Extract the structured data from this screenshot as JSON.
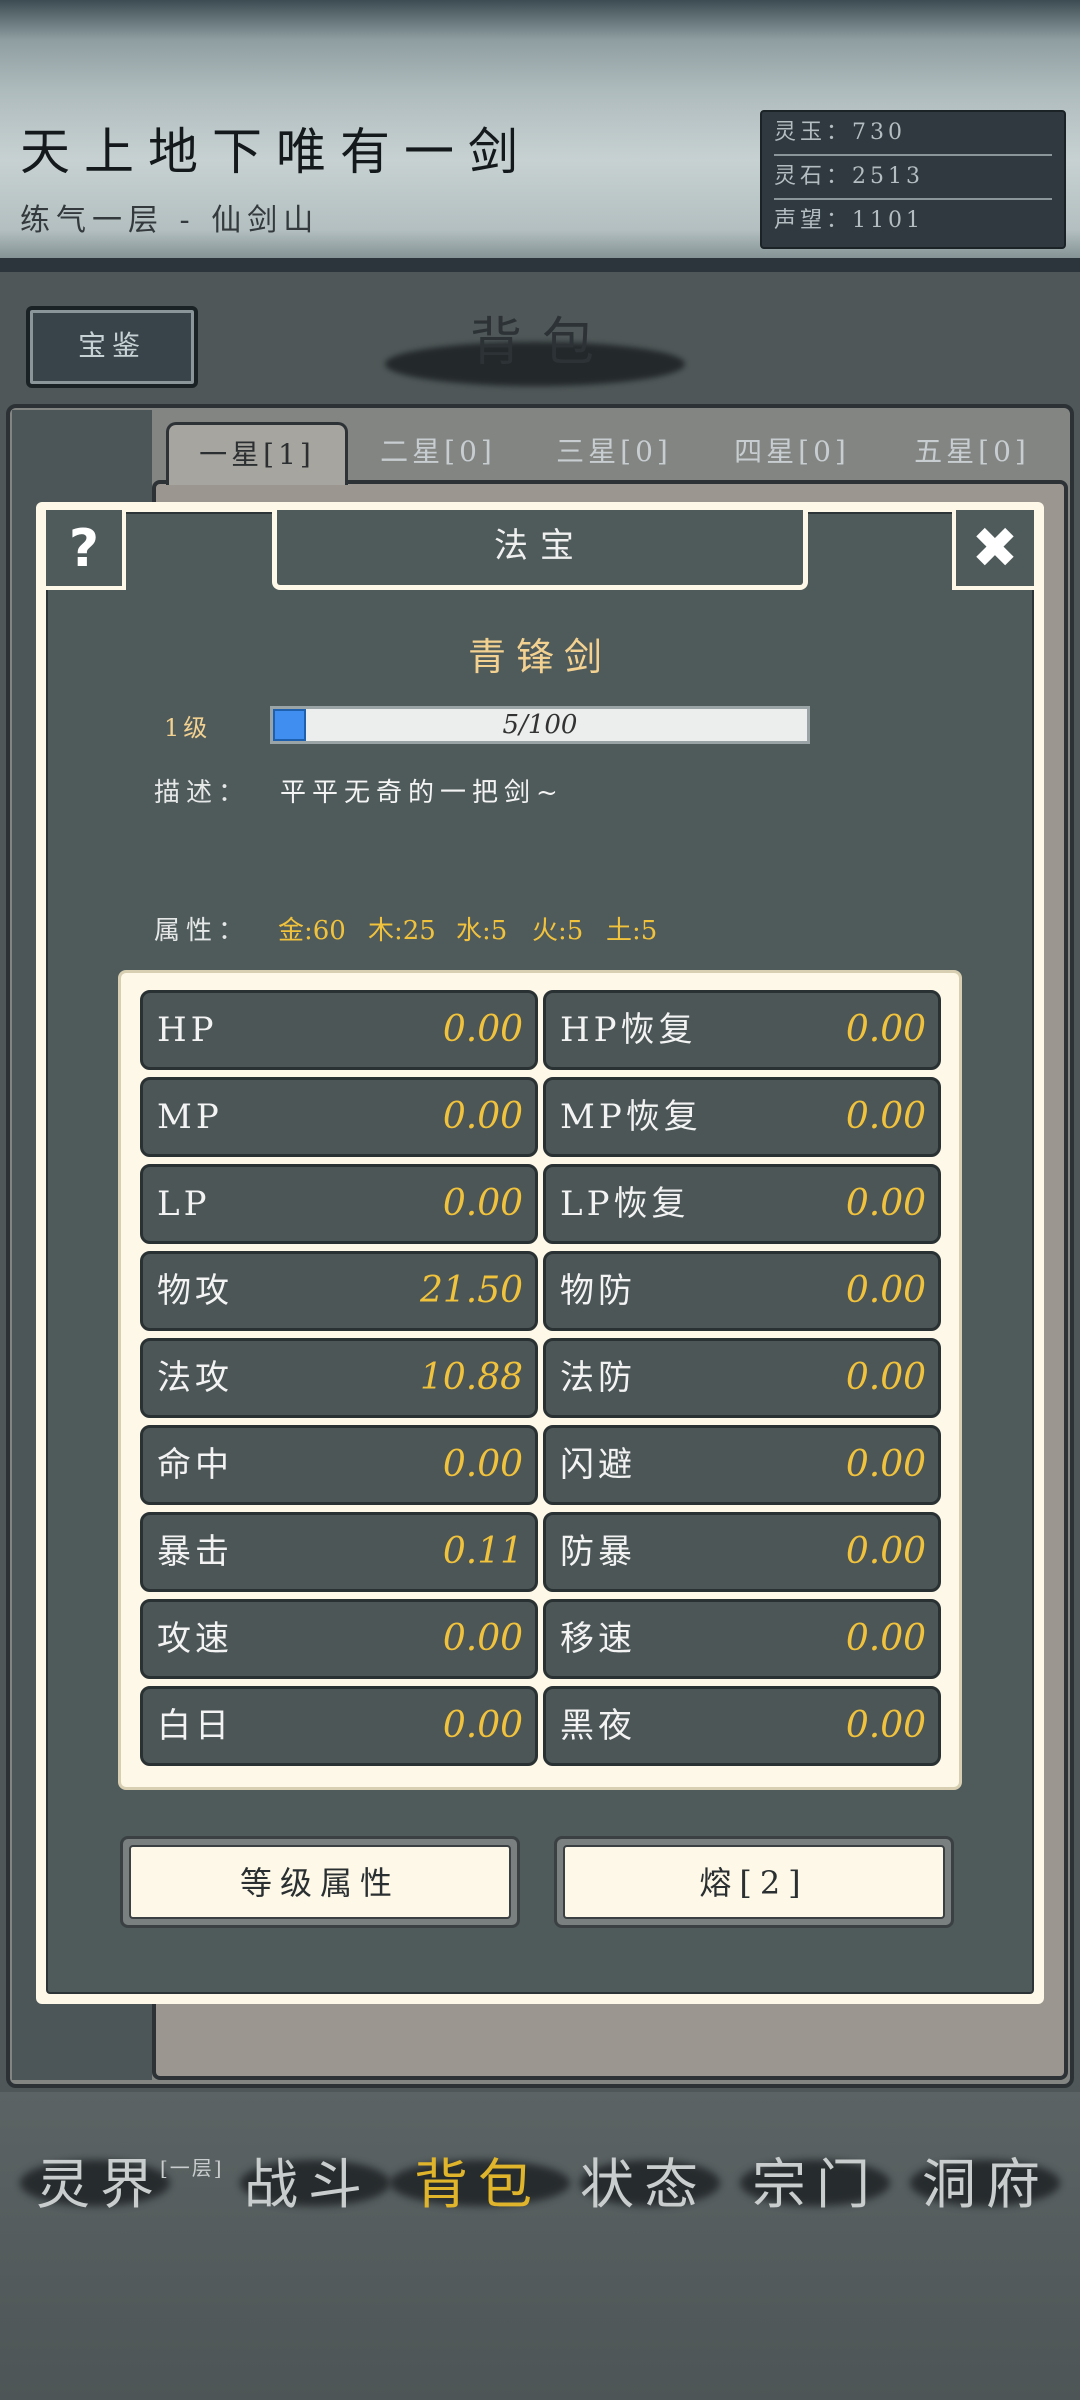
{
  "header": {
    "player_name": "天上地下唯有一剑",
    "realm_line": "练气一层 - 仙剑山",
    "stats": [
      {
        "label": "灵玉：730"
      },
      {
        "label": "灵石：2513"
      },
      {
        "label": "声望：1101"
      }
    ]
  },
  "toolbar": {
    "appraise_label": "宝鉴",
    "page_title": "背包"
  },
  "bag_tabs": [
    {
      "label": "一星[1]"
    },
    {
      "label": "二星[0]"
    },
    {
      "label": "三星[0]"
    },
    {
      "label": "四星[0]"
    },
    {
      "label": "五星[0]"
    }
  ],
  "modal": {
    "help_label": "?",
    "close_label": "✖",
    "header_tab": "法宝",
    "item_name": "青锋剑",
    "level_label": "1级",
    "exp_text": "5/100",
    "exp_progress": 0.05,
    "desc_label": "描述：",
    "desc_text": "平平无奇的一把剑~",
    "attr_label": "属性：",
    "elements": [
      "金:60",
      "木:25",
      "水:5",
      "火:5",
      "土:5"
    ],
    "stats": [
      {
        "label": "HP",
        "value": "0.00"
      },
      {
        "label": "HP恢复",
        "value": "0.00"
      },
      {
        "label": "MP",
        "value": "0.00"
      },
      {
        "label": "MP恢复",
        "value": "0.00"
      },
      {
        "label": "LP",
        "value": "0.00"
      },
      {
        "label": "LP恢复",
        "value": "0.00"
      },
      {
        "label": "物攻",
        "value": "21.50"
      },
      {
        "label": "物防",
        "value": "0.00"
      },
      {
        "label": "法攻",
        "value": "10.88"
      },
      {
        "label": "法防",
        "value": "0.00"
      },
      {
        "label": "命中",
        "value": "0.00"
      },
      {
        "label": "闪避",
        "value": "0.00"
      },
      {
        "label": "暴击",
        "value": "0.11"
      },
      {
        "label": "防暴",
        "value": "0.00"
      },
      {
        "label": "攻速",
        "value": "0.00"
      },
      {
        "label": "移速",
        "value": "0.00"
      },
      {
        "label": "白日",
        "value": "0.00"
      },
      {
        "label": "黑夜",
        "value": "0.00"
      }
    ],
    "level_attr_button": "等级属性",
    "smelt_button": "熔[2]"
  },
  "bottom_nav": {
    "items": [
      {
        "label": "灵界"
      },
      {
        "label": "战斗"
      },
      {
        "label": "背包"
      },
      {
        "label": "状态"
      },
      {
        "label": "宗门"
      },
      {
        "label": "洞府"
      }
    ],
    "realm_sub": "[一层]"
  },
  "colors": {
    "accent_gold": "#f1c23c",
    "exp_blue": "#3f8ef0",
    "panel_dark": "#4f5a5b",
    "cream": "#fdf8e7"
  }
}
